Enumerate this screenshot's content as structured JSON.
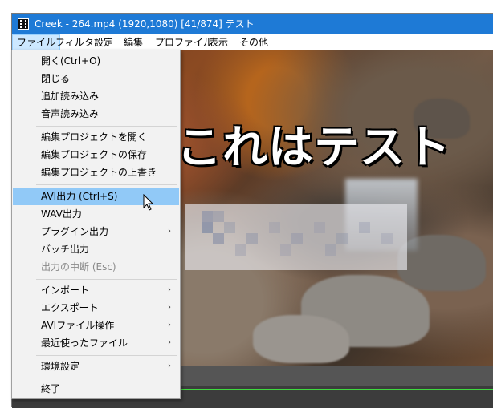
{
  "window": {
    "title": "Creek - 264.mp4 (1920,1080)  [41/874]  テスト"
  },
  "menubar": {
    "items": [
      "ファイル",
      "フィルタ",
      "設定",
      "編集",
      "プロファイル",
      "表示",
      "その他"
    ]
  },
  "video": {
    "overlay_text": "これはテスト"
  },
  "file_menu": {
    "items": [
      {
        "label": "開く(Ctrl+O)"
      },
      {
        "label": "閉じる"
      },
      {
        "label": "追加読み込み"
      },
      {
        "label": "音声読み込み"
      },
      {
        "label": "編集プロジェクトを開く"
      },
      {
        "label": "編集プロジェクトの保存"
      },
      {
        "label": "編集プロジェクトの上書き"
      },
      {
        "label": "AVI出力 (Ctrl+S)"
      },
      {
        "label": "WAV出力"
      },
      {
        "label": "プラグイン出力"
      },
      {
        "label": "バッチ出力"
      },
      {
        "label": "出力の中断 (Esc)"
      },
      {
        "label": "インポート"
      },
      {
        "label": "エクスポート"
      },
      {
        "label": "AVIファイル操作"
      },
      {
        "label": "最近使ったファイル"
      },
      {
        "label": "環境設定"
      },
      {
        "label": "終了"
      }
    ],
    "submenu_arrow": "›"
  },
  "colors": {
    "titlebar": "#1e7ad6",
    "highlight": "#91c9f7",
    "timeline_track": "#3fd93f"
  },
  "icons": [
    "app-icon",
    "submenu-arrow-icon",
    "mouse-cursor-icon"
  ]
}
